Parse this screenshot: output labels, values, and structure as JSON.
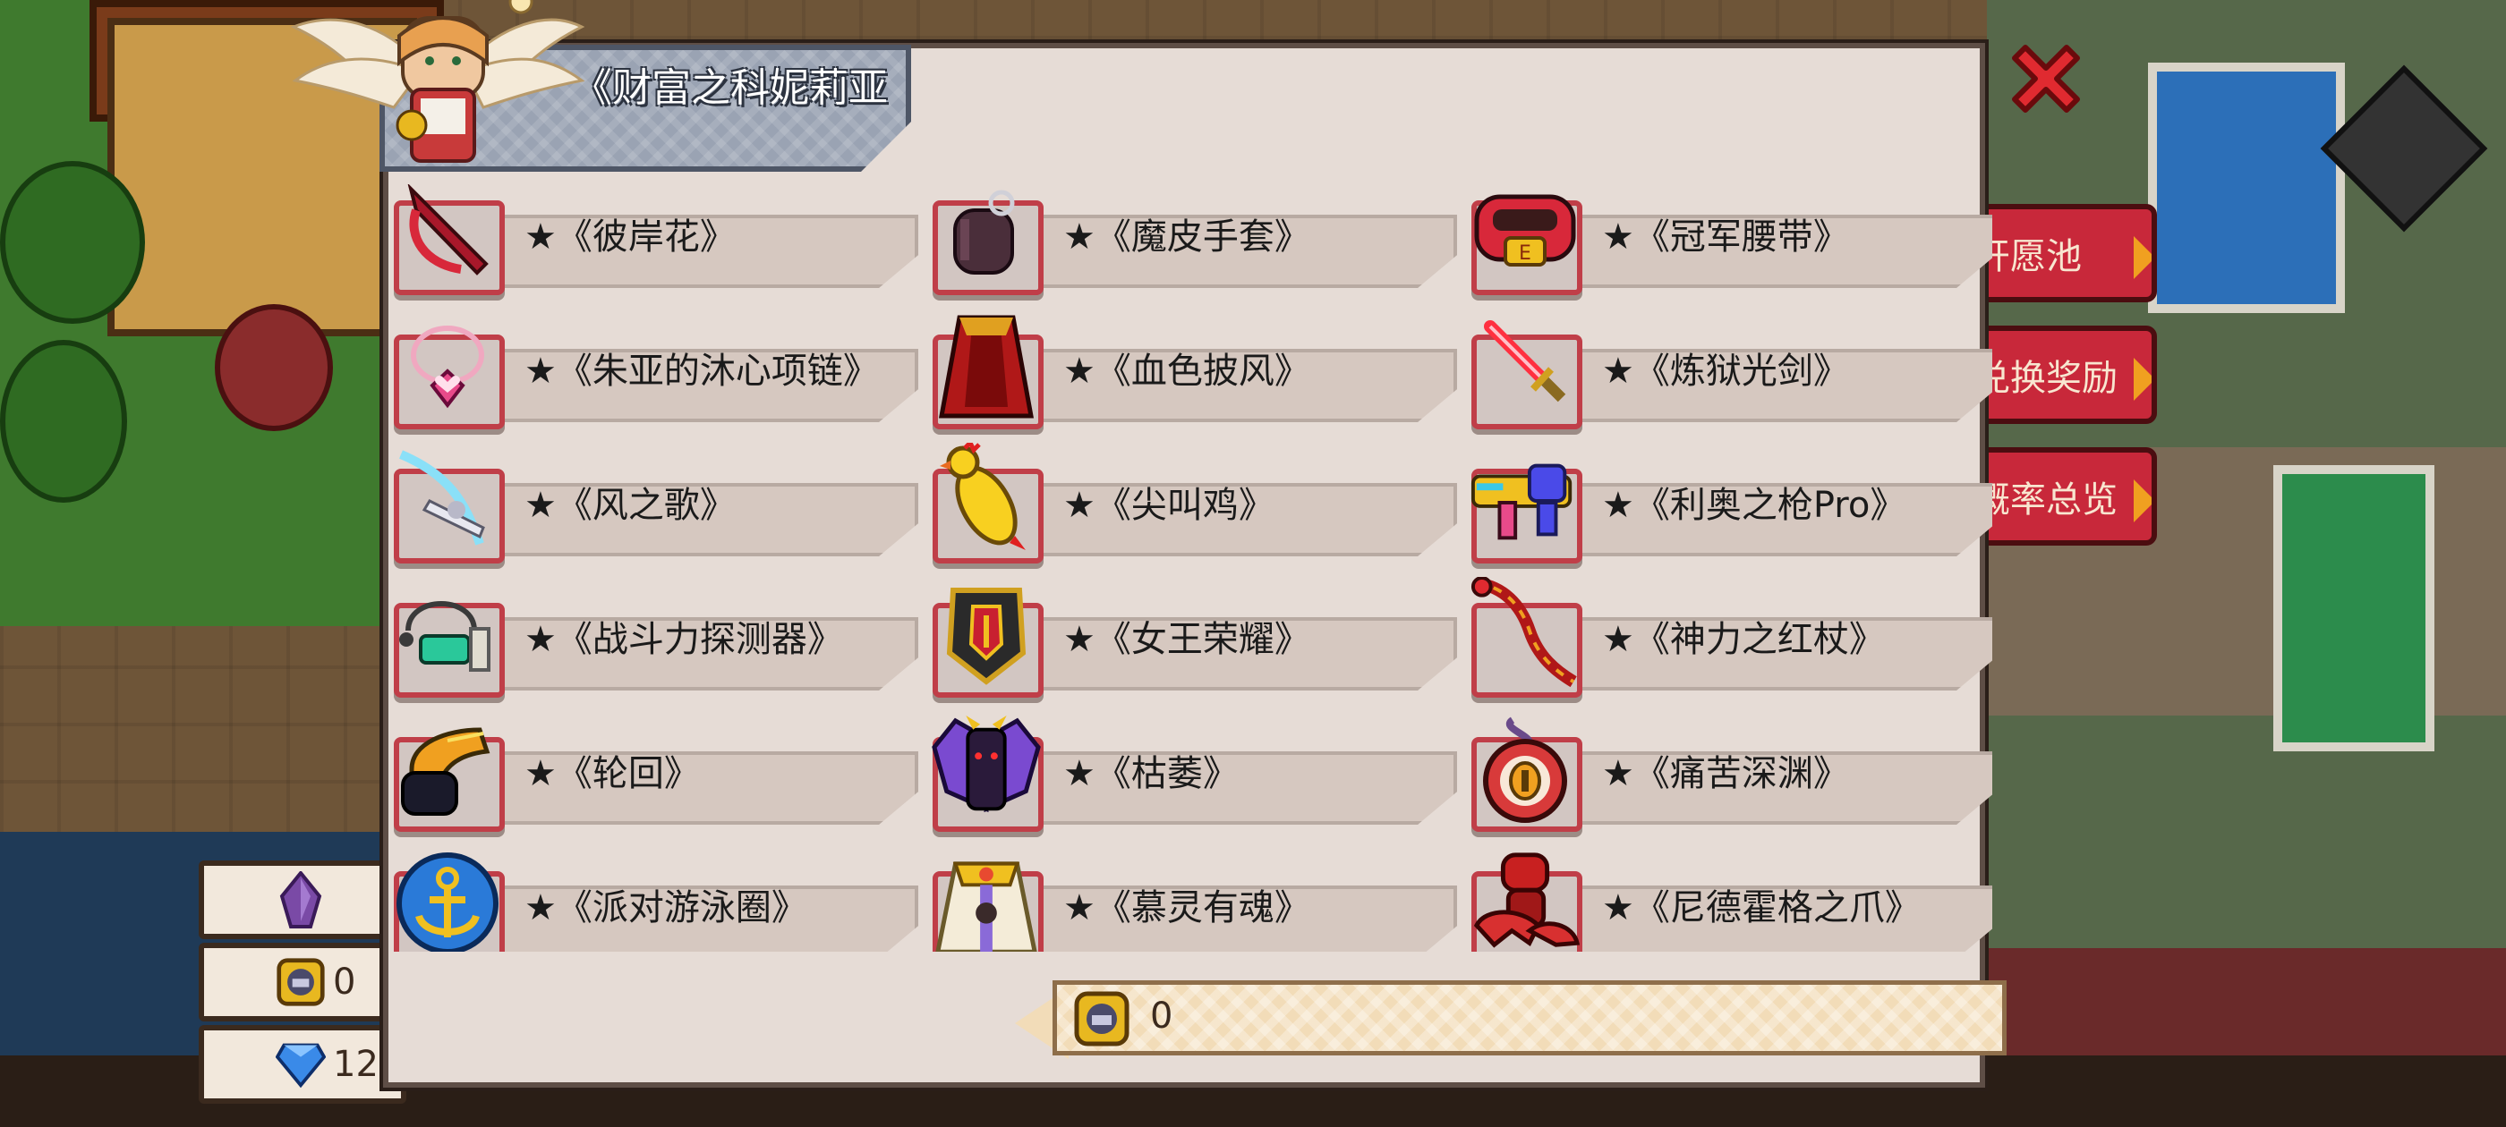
{
  "title": "《财富之科妮莉亚",
  "items": [
    {
      "label": "★《彼岸花》",
      "icon": "red-scythe-icon"
    },
    {
      "label": "★《魔皮手套》",
      "icon": "dark-glove-icon"
    },
    {
      "label": "★《冠军腰带》",
      "icon": "champion-belt-icon"
    },
    {
      "label": "★《朱亚的沐心项链》",
      "icon": "heart-necklace-icon"
    },
    {
      "label": "★《血色披风》",
      "icon": "red-cape-icon"
    },
    {
      "label": "★《炼狱光剑》",
      "icon": "lightsaber-icon"
    },
    {
      "label": "★《风之歌》",
      "icon": "wind-blade-icon"
    },
    {
      "label": "★《尖叫鸡》",
      "icon": "rubber-chicken-icon"
    },
    {
      "label": "★《利奥之枪Pro》",
      "icon": "water-gun-icon"
    },
    {
      "label": "★《战斗力探测器》",
      "icon": "scouter-icon"
    },
    {
      "label": "★《女王荣耀》",
      "icon": "shield-icon"
    },
    {
      "label": "★《神力之红杖》",
      "icon": "red-staff-icon"
    },
    {
      "label": "★《轮回》",
      "icon": "claw-gauntlet-icon"
    },
    {
      "label": "★《枯萎》",
      "icon": "bat-wings-icon"
    },
    {
      "label": "★《痛苦深渊》",
      "icon": "eye-orb-icon"
    },
    {
      "label": "★《派对游泳圈》",
      "icon": "anchor-ring-icon"
    },
    {
      "label": "★《慕灵有魂》",
      "icon": "golden-robe-icon"
    },
    {
      "label": "★《尼德霍格之爪》",
      "icon": "dragon-claw-icon"
    }
  ],
  "balance": {
    "value": "0",
    "icon": "token-coin-icon"
  },
  "side_currencies": [
    {
      "icon": "purple-crystal-icon",
      "value": ""
    },
    {
      "icon": "token-coin-icon",
      "value": "0"
    },
    {
      "icon": "blue-diamond-icon",
      "value": "12"
    }
  ],
  "side_buttons": [
    "开愿池",
    "兑换奖励",
    "概率总览"
  ],
  "colors": {
    "panel": "#e6dcd6",
    "slot_border": "#c03e48",
    "title_tab": "#9aa3b3",
    "close": "#e02a30"
  }
}
